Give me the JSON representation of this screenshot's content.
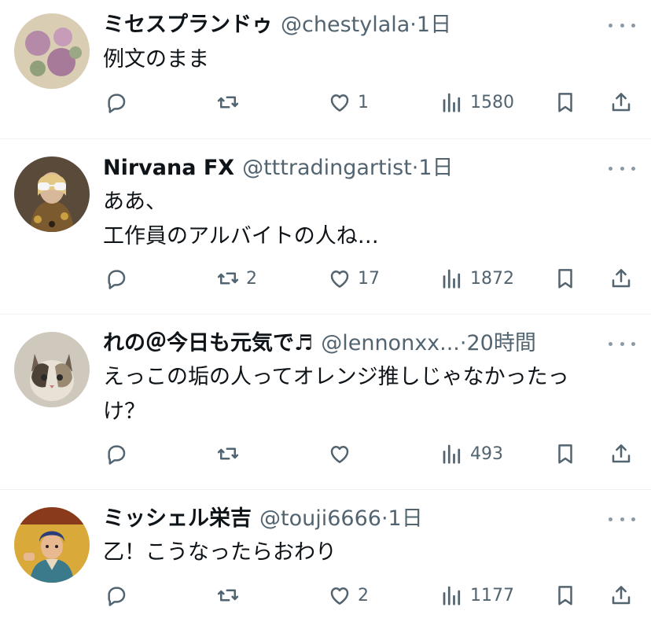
{
  "tweets": [
    {
      "name": "ミセスプランドゥ",
      "handle": "@chestylala",
      "separator": "·",
      "time": "1日",
      "text": "例文のまま",
      "replies": "",
      "retweets": "",
      "likes": "1",
      "views": "1580"
    },
    {
      "name": "Nirvana FX",
      "handle": "@tttradingartist",
      "separator": "·",
      "time": "1日",
      "text": "ああ、\n工作員のアルバイトの人ね…",
      "replies": "",
      "retweets": "2",
      "likes": "17",
      "views": "1872"
    },
    {
      "name": "れの＠今日も元気で♬",
      "handle": "@lennonxx...",
      "separator": "·",
      "time": "20時間",
      "text": "えっこの垢の人ってオレンジ推しじゃなかったっ\nけ？",
      "replies": "",
      "retweets": "",
      "likes": "",
      "views": "493"
    },
    {
      "name": "ミッシェル栄吉",
      "handle": "@touji6666",
      "separator": "·",
      "time": "1日",
      "text": "乙！こうなったらおわり",
      "replies": "",
      "retweets": "",
      "likes": "2",
      "views": "1177"
    }
  ],
  "icons": {
    "reply": "reply-icon",
    "retweet": "retweet-icon",
    "like": "heart-icon",
    "views": "views-icon",
    "bookmark": "bookmark-icon",
    "share": "share-icon",
    "more": "more-icon"
  },
  "colors": {
    "text": "#0f1419",
    "secondary": "#536471",
    "divider": "#eff3f4"
  }
}
